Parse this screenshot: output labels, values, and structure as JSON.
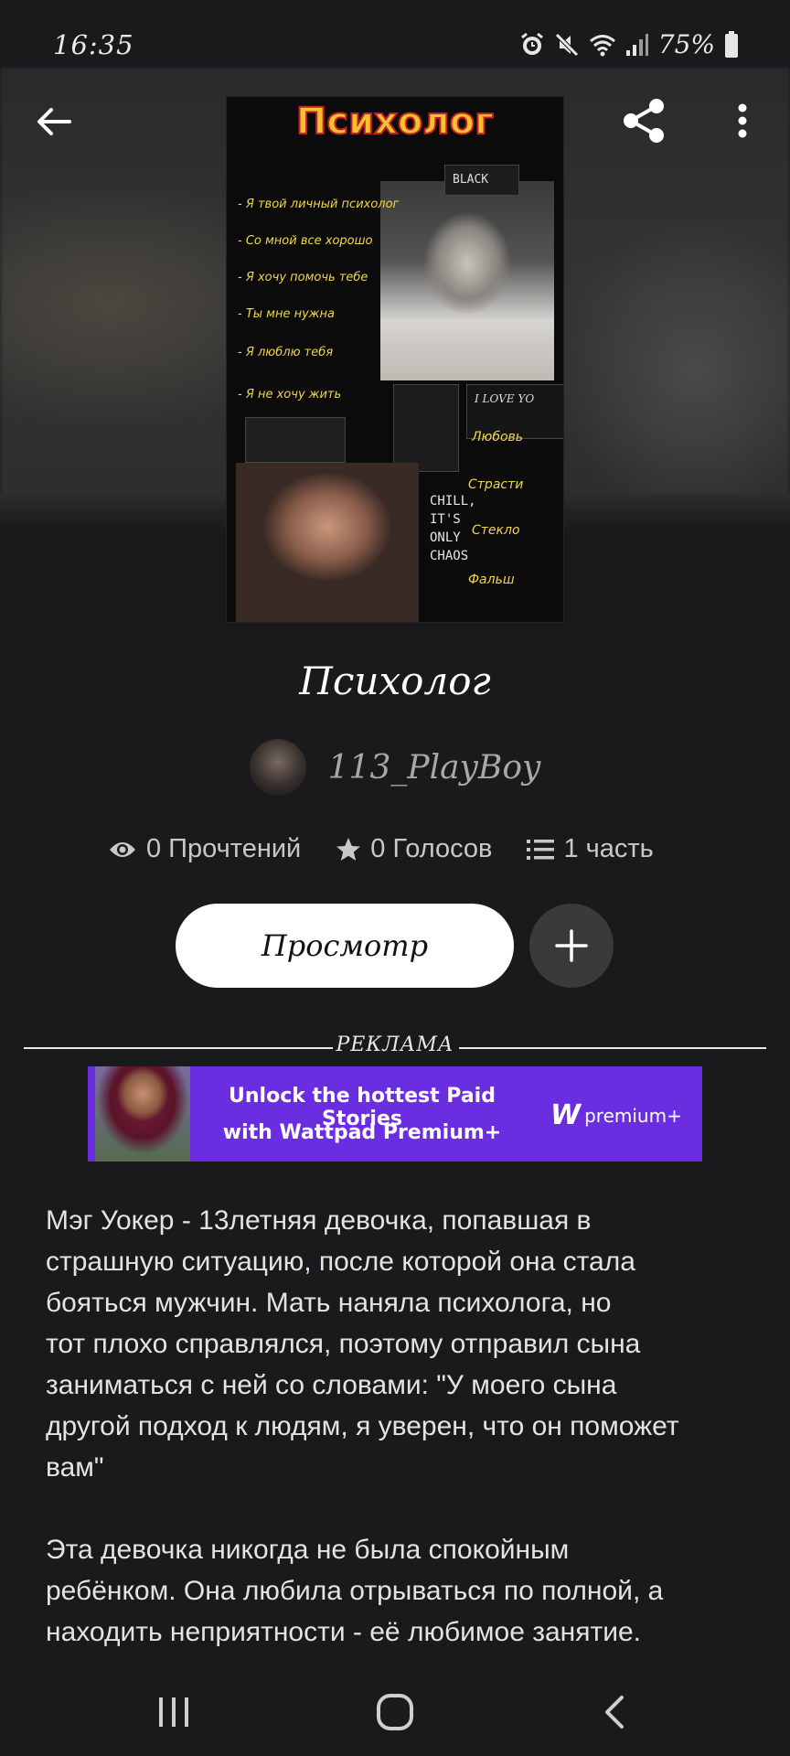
{
  "status_bar": {
    "time": "16:35",
    "battery": "75%",
    "icons": [
      "alarm-icon",
      "mute-icon",
      "wifi-icon",
      "signal-icon",
      "battery-icon"
    ]
  },
  "header": {
    "back_icon": "arrow-left-icon",
    "share_icon": "share-icon",
    "more_icon": "more-vertical-icon"
  },
  "cover": {
    "title": "Психолог",
    "lines": [
      "- Я твой личный психолог",
      "- Со мной все хорошо",
      "- Я хочу помочь тебе",
      "- Ты мне нужна",
      "- Я люблю тебя",
      "- Я не хочу жить"
    ],
    "black_label": "BLACK",
    "love_label": "I LOVE YO",
    "words": [
      "Любовь",
      "Страсти",
      "Стекло",
      "Фальш"
    ],
    "chaos": "CHILL,\nIT'S\nONLY\nCHAOS"
  },
  "story": {
    "title": "Психолог",
    "author": "113_PlayBoy",
    "stats": {
      "reads": "0 Прочтений",
      "votes": "0 Голосов",
      "parts": "1 часть"
    },
    "view_button": "Просмотр"
  },
  "ad": {
    "label": "РЕКЛАМА",
    "line1": "Unlock the hottest Paid Stories",
    "line2": "with Wattpad Premium+",
    "logo_mark": "W",
    "logo_text": "premium+"
  },
  "description": {
    "paragraph1": "Мэг Уокер - 13летняя девочка, попавшая в\nстрашную ситуацию, после которой она стала\nбояться мужчин. Мать наняла психолога, но\nтот плохо справлялся, поэтому отправил сына\nзаниматься с ней со словами: \"У моего сына\nдругой подход к людям, я уверен, что он поможет\nвам\"",
    "paragraph2": "Эта девочка никогда не была спокойным\nребёнком. Она любила отрываться  по полной, а\nнаходить неприятности - её любимое занятие."
  },
  "colors": {
    "background": "#1a191c",
    "ad_purple": "#6a2ee0",
    "cover_title_yellow": "#f4c230",
    "cover_title_red": "#c32222"
  }
}
